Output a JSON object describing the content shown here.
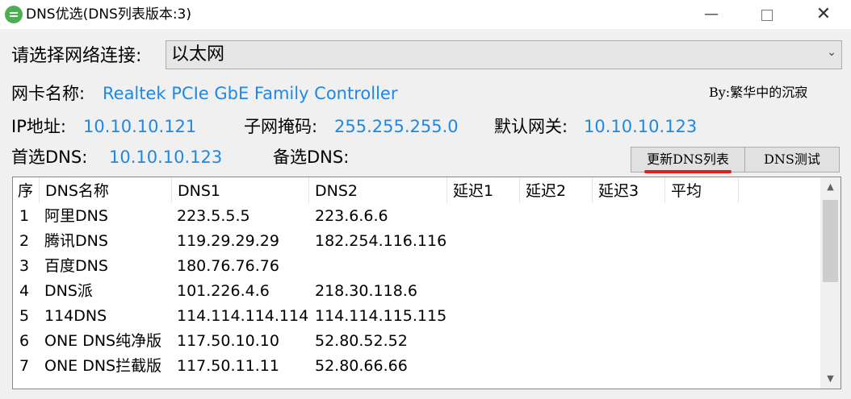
{
  "window": {
    "title": "DNS优选(DNS列表版本:3)",
    "min_glyph": "—",
    "close_glyph": "✕"
  },
  "connection": {
    "label": "请选择网络连接:",
    "selected": "以太网",
    "arrow": "⌄"
  },
  "adapter": {
    "label": "网卡名称:",
    "value": "Realtek PCIe GbE Family Controller"
  },
  "author": "By:繁华中的沉寂",
  "ip": {
    "label": "IP地址:",
    "value": "10.10.10.121"
  },
  "subnet": {
    "label": "子网掩码:",
    "value": "255.255.255.0"
  },
  "gateway": {
    "label": "默认网关:",
    "value": "10.10.10.123"
  },
  "dns_primary": {
    "label": "首选DNS:",
    "value": "10.10.10.123"
  },
  "dns_secondary": {
    "label": "备选DNS:",
    "value": ""
  },
  "buttons": {
    "update": "更新DNS列表",
    "test": "DNS测试"
  },
  "accent_colors": {
    "value_text": "#1e88e5",
    "highlight": "#e02020"
  },
  "table": {
    "columns": [
      "序",
      "DNS名称",
      "DNS1",
      "DNS2",
      "延迟1",
      "延迟2",
      "延迟3",
      "平均"
    ],
    "rows": [
      [
        "1",
        "阿里DNS",
        "223.5.5.5",
        "223.6.6.6",
        "",
        "",
        "",
        ""
      ],
      [
        "2",
        "腾讯DNS",
        "119.29.29.29",
        "182.254.116.116",
        "",
        "",
        "",
        ""
      ],
      [
        "3",
        "百度DNS",
        "180.76.76.76",
        "",
        "",
        "",
        "",
        ""
      ],
      [
        "4",
        "DNS派",
        "101.226.4.6",
        "218.30.118.6",
        "",
        "",
        "",
        ""
      ],
      [
        "5",
        "114DNS",
        "114.114.114.114",
        "114.114.115.115",
        "",
        "",
        "",
        ""
      ],
      [
        "6",
        "ONE DNS纯净版",
        "117.50.10.10",
        "52.80.52.52",
        "",
        "",
        "",
        ""
      ],
      [
        "7",
        "ONE DNS拦截版",
        "117.50.11.11",
        "52.80.66.66",
        "",
        "",
        "",
        ""
      ]
    ],
    "scroll_up": "▲",
    "scroll_down": "▼"
  }
}
